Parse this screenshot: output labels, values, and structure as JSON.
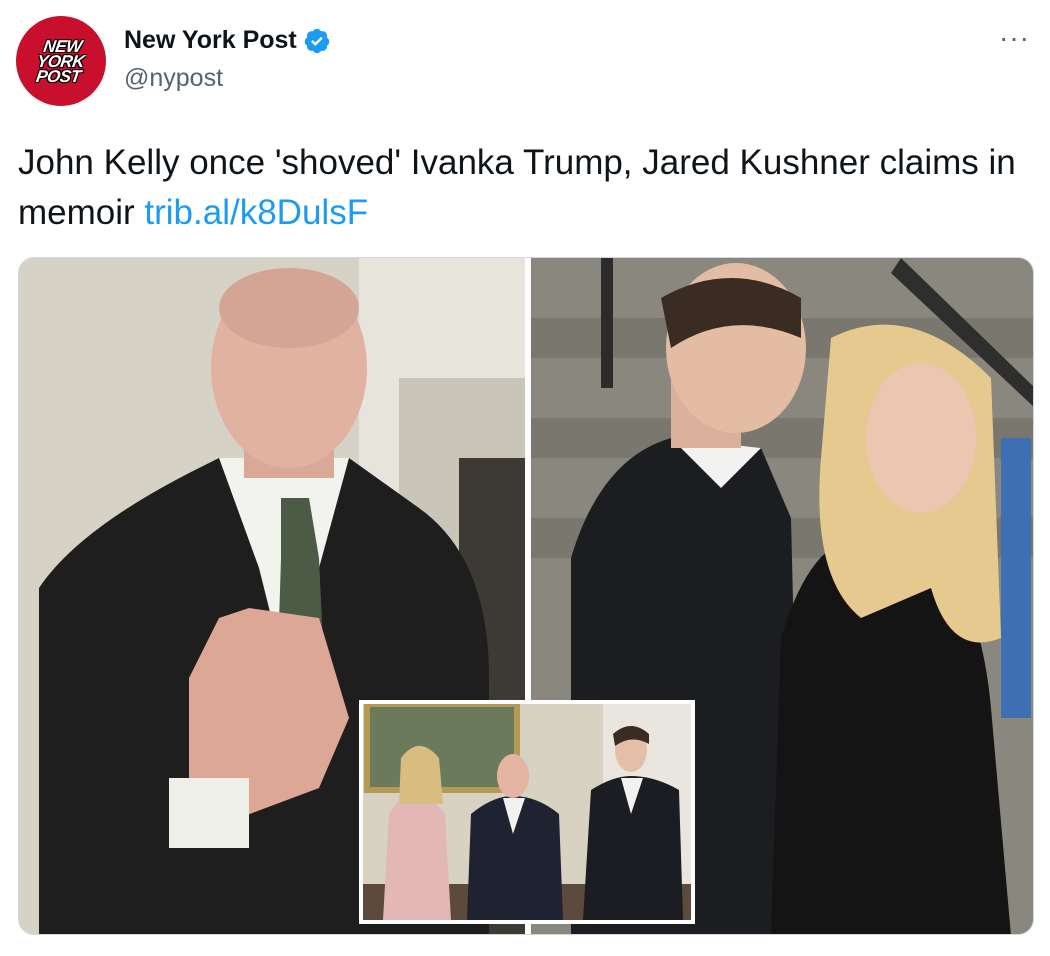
{
  "account": {
    "display_name": "New York Post",
    "handle": "@nypost",
    "avatar_logo_lines": [
      "NEW",
      "YORK",
      "POST"
    ],
    "verified_icon": "verified-badge-icon",
    "menu_icon": "more-options-icon",
    "menu_glyph": "···"
  },
  "tweet": {
    "text": "John Kelly once 'shoved' Ivanka Trump, Jared Kushner claims in memoir ",
    "link_text": "trib.al/k8DulsF"
  },
  "colors": {
    "brand": "#c8102e",
    "link": "#1d9bf0",
    "verified": "#1d9bf0",
    "secondary_text": "#536471"
  }
}
